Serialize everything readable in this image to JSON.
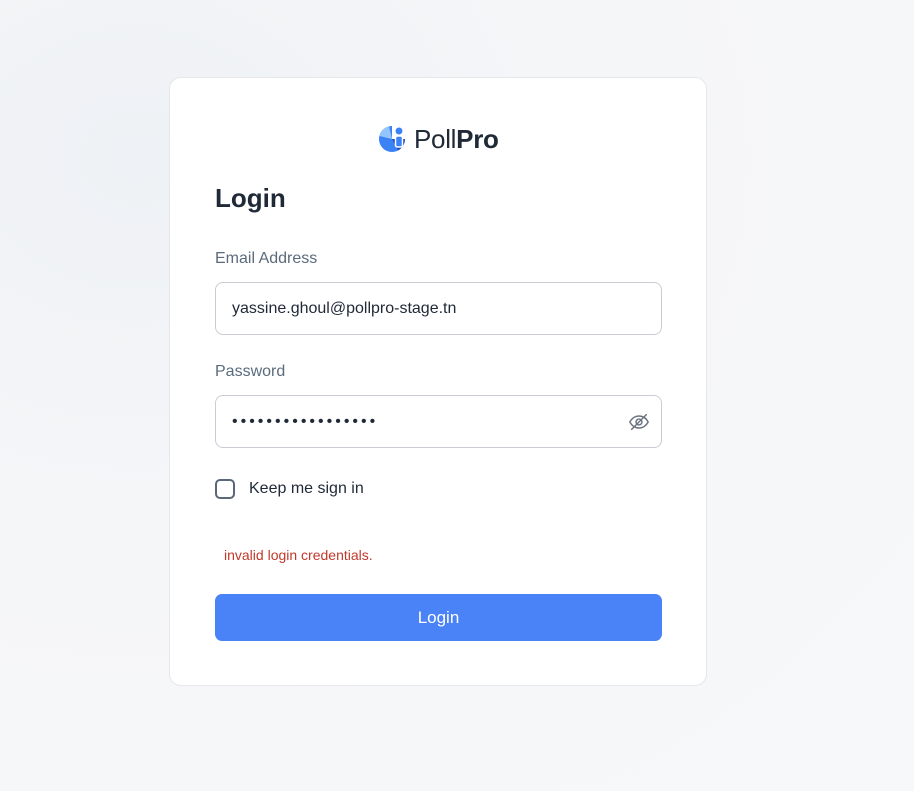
{
  "brand": {
    "name_light": "Poll",
    "name_bold": "Pro",
    "logo_icon": "pollpro-logo-icon",
    "accent_color": "#4a82f7"
  },
  "form": {
    "title": "Login",
    "email": {
      "label": "Email Address",
      "value": "yassine.ghoul@pollpro-stage.tn"
    },
    "password": {
      "label": "Password",
      "value": "•••••••••••••••••",
      "toggle_icon": "eye-off-icon"
    },
    "remember": {
      "label": "Keep me sign in",
      "checked": false
    },
    "error_message": "invalid login credentials.",
    "error_color": "#c0392b",
    "submit_label": "Login"
  }
}
